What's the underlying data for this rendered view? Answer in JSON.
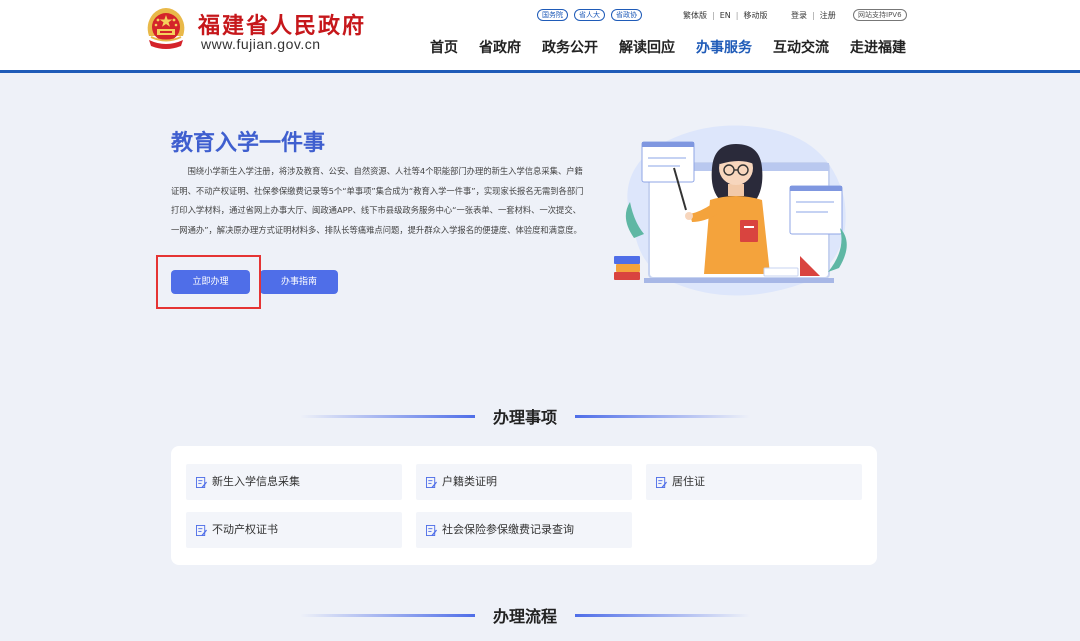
{
  "header": {
    "logo_title": "福建省人民政府",
    "logo_url": "www.fujian.gov.cn",
    "org_links": [
      "国务院",
      "省人大",
      "省政协"
    ],
    "util_links": [
      "繁体版",
      "EN",
      "移动版"
    ],
    "account_links": [
      "登录",
      "注册"
    ],
    "ipv6_badge": "网站支持IPV6",
    "nav": [
      "首页",
      "省政府",
      "政务公开",
      "解读回应",
      "办事服务",
      "互动交流",
      "走进福建"
    ],
    "active_nav": "办事服务"
  },
  "hero": {
    "title": "教育入学一件事",
    "description": "围绕小学新生入学注册，将涉及教育、公安、自然资源、人社等4个职能部门办理的新生入学信息采集、户籍证明、不动产权证明、社保参保缴费记录等5个“单事项”集合成为“教育入学一件事”，实现家长报名无需到各部门打印入学材料，通过省网上办事大厅、闽政通APP、线下市县级政务服务中心“一张表单、一套材料、一次提交、一网通办”，解决原办理方式证明材料多、排队长等痛难点问题，提升群众入学报名的便捷度、体验度和满意度。",
    "apply_button": "立即办理",
    "guide_button": "办事指南"
  },
  "sections": {
    "items_title": "办理事项",
    "process_title": "办理流程"
  },
  "items": [
    "新生入学信息采集",
    "户籍类证明",
    "居住证",
    "不动产权证书",
    "社会保险参保缴费记录查询"
  ],
  "colors": {
    "brand_blue": "#1f5bb8",
    "logo_red": "#c6171b",
    "button_blue": "#4f6ee8",
    "highlight_red": "#e53434",
    "background": "#eef1f8"
  }
}
